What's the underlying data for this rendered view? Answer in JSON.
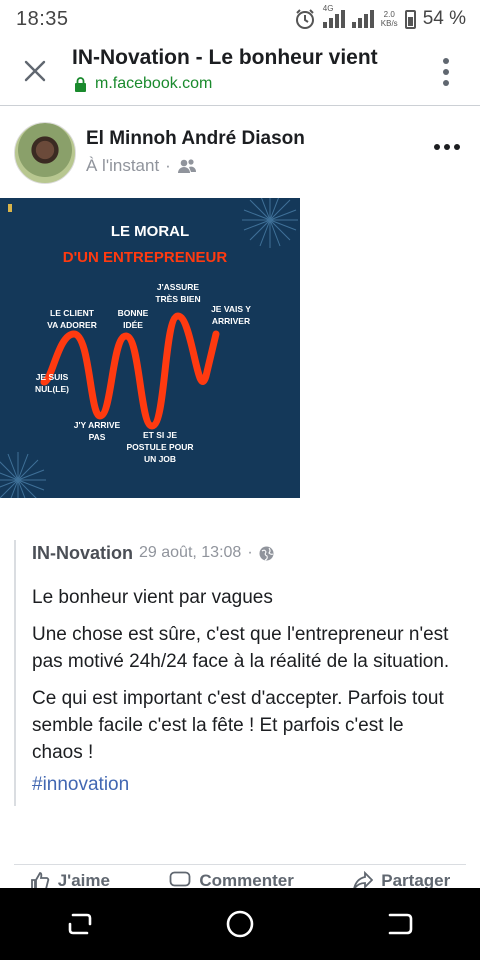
{
  "status_bar": {
    "time": "18:35",
    "network_label": "4G",
    "speed_value": "2.0",
    "speed_unit": "KB/s",
    "battery": "54 %",
    "icons": [
      "alarm-icon",
      "signal-icon",
      "battery-icon"
    ]
  },
  "browser": {
    "title": "IN-Novation - Le bonheur vient",
    "url": "m.facebook.com",
    "url_color": "#1a8a2d"
  },
  "post": {
    "author": "El Minnoh André Diason",
    "time": "À l'instant",
    "separator": "·",
    "audience_icon": "friends-icon"
  },
  "image": {
    "title_line1": "LE MORAL",
    "title_line2": "D'UN ENTREPRENEUR",
    "labels": {
      "client": [
        "LE CLIENT",
        "VA ADORER"
      ],
      "idee": [
        "BONNE",
        "IDÉE"
      ],
      "assure": [
        "J'ASSURE",
        "TRÈS BIEN"
      ],
      "vais": [
        "JE VAIS Y",
        "ARRIVER"
      ],
      "nul": [
        "JE SUIS",
        "NUL(LE)"
      ],
      "arrive": [
        "J'Y ARRIVE",
        "PAS"
      ],
      "postule": [
        "ET SI JE",
        "POSTULE POUR",
        "UN JOB"
      ]
    },
    "accent_color": "#ff3a10",
    "background_color": "#143859"
  },
  "shared_post": {
    "page_name": "IN-Novation",
    "date": "29 août, 13:08",
    "separator": "·",
    "paragraphs": [
      "Le bonheur vient par vagues",
      "Une chose est sûre, c'est que l'entrepreneur n'est pas motivé 24h/24 face à la réalité de la situation.",
      "Ce qui est important c'est d'accepter. Parfois tout semble facile c'est la fête ! Et parfois c'est le chaos !"
    ],
    "hashtag": "#innovation"
  },
  "actions": {
    "like": "J'aime",
    "comment": "Commenter",
    "share": "Partager"
  }
}
